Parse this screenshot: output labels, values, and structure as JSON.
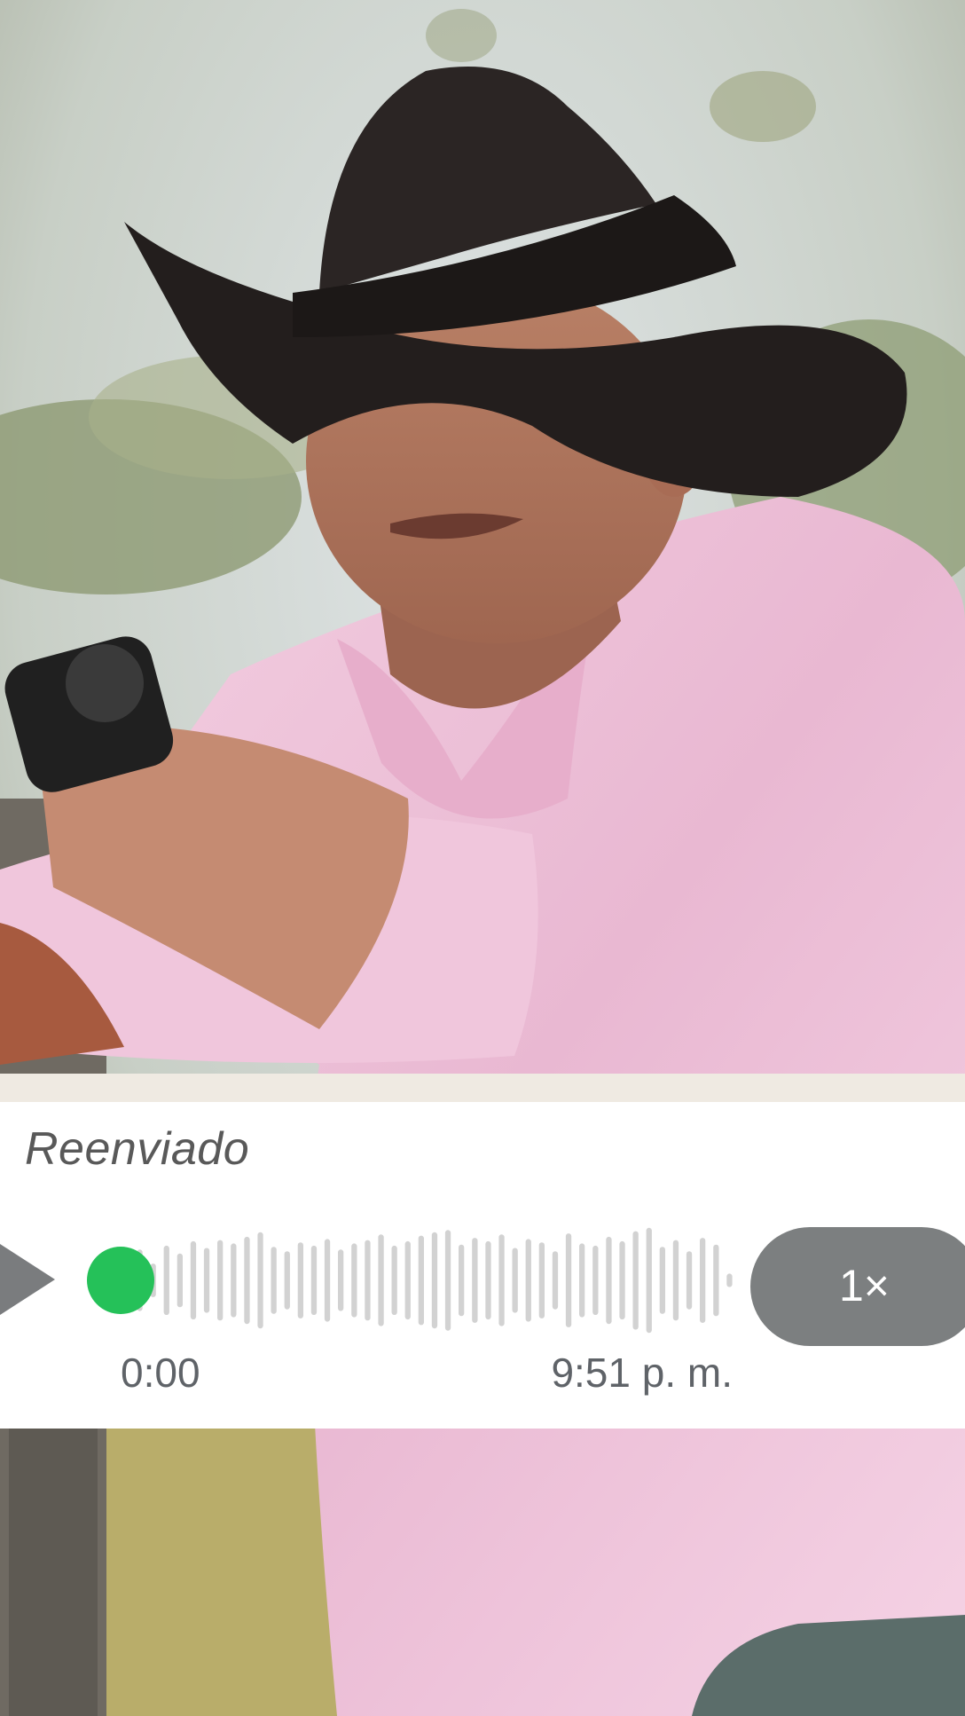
{
  "message": {
    "forwarded_label": "Reenviado",
    "voice_note": {
      "elapsed_time": "0:00",
      "sent_time": "9:51 p. m.",
      "playback_speed": "1×",
      "progress": 0,
      "play_icon": "play-icon",
      "waveform_levels": [
        0.55,
        0.3,
        0.62,
        0.48,
        0.7,
        0.58,
        0.72,
        0.66,
        0.78,
        0.86,
        0.6,
        0.52,
        0.68,
        0.62,
        0.74,
        0.55,
        0.66,
        0.72,
        0.82,
        0.62,
        0.7,
        0.8,
        0.86,
        0.9,
        0.64,
        0.76,
        0.7,
        0.82,
        0.58,
        0.74,
        0.68,
        0.52,
        0.84,
        0.66,
        0.62,
        0.78,
        0.7,
        0.88,
        0.94,
        0.6,
        0.72,
        0.52,
        0.76,
        0.64,
        0.12
      ]
    },
    "colors": {
      "bubble": "#ffffff",
      "accent_green": "#25c159",
      "waveform": "#d2d2d2",
      "speed_button": "#7c7f80",
      "chat_background": "#efeae2"
    }
  }
}
